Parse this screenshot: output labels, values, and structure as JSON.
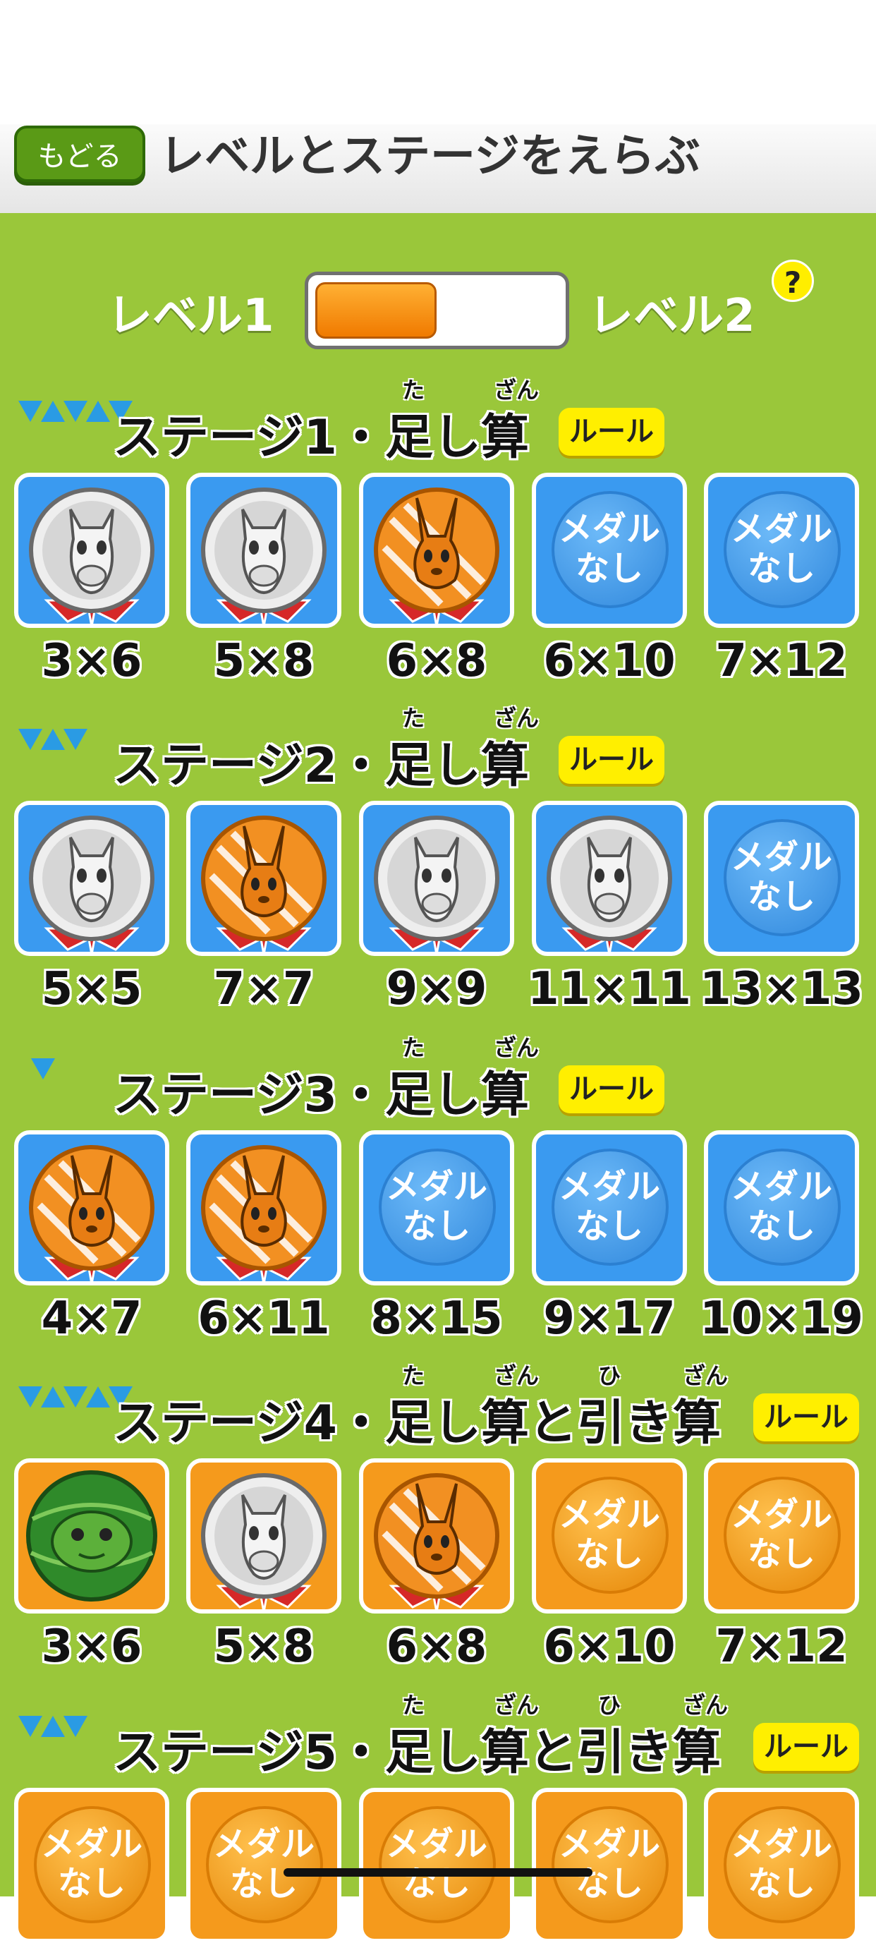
{
  "header": {
    "back_label": "もどる",
    "title": "レベルとステージをえらぶ"
  },
  "level": {
    "left_label": "レベル1",
    "right_label": "レベル2",
    "selected": 1,
    "toggle_fill": 0.5,
    "help_label": "?"
  },
  "rule_label": "ルール",
  "stages": [
    {
      "title": "ステージ1・足し算",
      "furigana": [
        "た",
        "ざん"
      ],
      "difficulty": 3,
      "color": "blue",
      "tiles": [
        {
          "medal": "silver-horse",
          "label": "3×6"
        },
        {
          "medal": "silver-horse",
          "label": "5×8"
        },
        {
          "medal": "bronze-rabbit",
          "label": "6×8"
        },
        {
          "medal": "none",
          "text": "メダル\nなし",
          "label": "6×10"
        },
        {
          "medal": "none",
          "text": "メダル\nなし",
          "label": "7×12"
        }
      ]
    },
    {
      "title": "ステージ2・足し算",
      "furigana": [
        "た",
        "ざん"
      ],
      "difficulty": 2,
      "color": "blue",
      "tiles": [
        {
          "medal": "silver-horse",
          "label": "5×5"
        },
        {
          "medal": "bronze-rabbit",
          "label": "7×7"
        },
        {
          "medal": "silver-horse",
          "label": "9×9"
        },
        {
          "medal": "silver-horse",
          "label": "11×11"
        },
        {
          "medal": "none",
          "text": "メダル\nなし",
          "label": "13×13"
        }
      ]
    },
    {
      "title": "ステージ3・足し算",
      "furigana": [
        "た",
        "ざん"
      ],
      "difficulty": 1,
      "color": "blue",
      "tiles": [
        {
          "medal": "bronze-rabbit",
          "label": "4×7"
        },
        {
          "medal": "bronze-rabbit",
          "label": "6×11"
        },
        {
          "medal": "none",
          "text": "メダル\nなし",
          "label": "8×15"
        },
        {
          "medal": "none",
          "text": "メダル\nなし",
          "label": "9×17"
        },
        {
          "medal": "none",
          "text": "メダル\nなし",
          "label": "10×19"
        }
      ]
    },
    {
      "title": "ステージ4・足し算と引き算",
      "furigana": [
        "た",
        "ざん",
        "ひ",
        "ざん"
      ],
      "difficulty": 3,
      "color": "orange",
      "tiles": [
        {
          "medal": "green-turtle",
          "label": "3×6"
        },
        {
          "medal": "silver-horse",
          "label": "5×8"
        },
        {
          "medal": "bronze-rabbit",
          "label": "6×8"
        },
        {
          "medal": "none",
          "text": "メダル\nなし",
          "label": "6×10"
        },
        {
          "medal": "none",
          "text": "メダル\nなし",
          "label": "7×12"
        }
      ]
    },
    {
      "title": "ステージ5・足し算と引き算",
      "furigana": [
        "た",
        "ざん",
        "ひ",
        "ざん"
      ],
      "difficulty": 2,
      "color": "orange",
      "tiles": [
        {
          "medal": "none",
          "text": "メダル\nなし"
        },
        {
          "medal": "none",
          "text": "メダル\nなし"
        },
        {
          "medal": "none",
          "text": "メダル\nなし"
        },
        {
          "medal": "none",
          "text": "メダル\nなし"
        },
        {
          "medal": "none",
          "text": "メダル\nなし"
        }
      ]
    }
  ]
}
